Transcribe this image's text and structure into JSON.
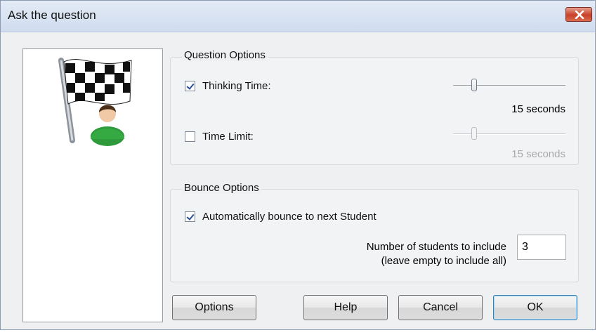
{
  "window": {
    "title": "Ask the question"
  },
  "question_options": {
    "label": "Question Options",
    "thinking_time": {
      "label": "Thinking Time:",
      "checked": true,
      "value_text": "15 seconds",
      "slider_level": 0.2
    },
    "time_limit": {
      "label": "Time Limit:",
      "checked": false,
      "value_text": "15 seconds",
      "slider_level": 0.2
    }
  },
  "bounce_options": {
    "label": "Bounce Options",
    "auto_bounce": {
      "label": "Automatically bounce to next Student",
      "checked": true
    },
    "students_label_line1": "Number of students to include",
    "students_label_line2": "(leave empty to include all)",
    "students_value": "3"
  },
  "buttons": {
    "options": "Options",
    "help": "Help",
    "cancel": "Cancel",
    "ok": "OK"
  },
  "colors": {
    "accent": "#3c7fb1",
    "flag_person": "#2f9a3c",
    "close": "#c8412a"
  }
}
